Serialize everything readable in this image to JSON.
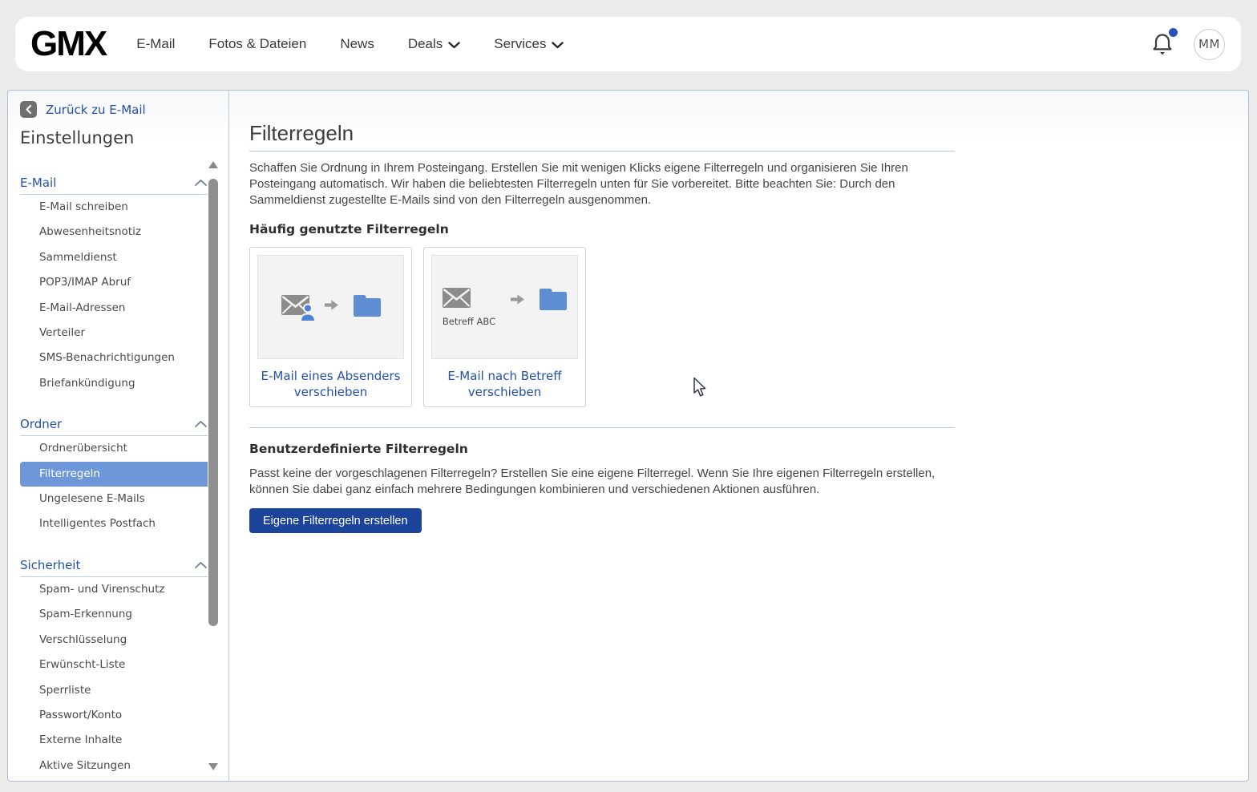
{
  "header": {
    "logo": "GMX",
    "nav": [
      {
        "label": "E-Mail",
        "has_dropdown": false
      },
      {
        "label": "Fotos & Dateien",
        "has_dropdown": false
      },
      {
        "label": "News",
        "has_dropdown": false
      },
      {
        "label": "Deals",
        "has_dropdown": true
      },
      {
        "label": "Services",
        "has_dropdown": true
      }
    ],
    "notification": {
      "icon": "bell-icon",
      "has_unread_dot": true
    },
    "avatar_initials": "MM"
  },
  "sidebar": {
    "back_link": "Zurück zu E-Mail",
    "title": "Einstellungen",
    "sections": [
      {
        "label": "E-Mail",
        "collapsed": false,
        "items": [
          {
            "label": "E-Mail schreiben",
            "selected": false
          },
          {
            "label": "Abwesenheitsnotiz",
            "selected": false
          },
          {
            "label": "Sammeldienst",
            "selected": false
          },
          {
            "label": "POP3/IMAP Abruf",
            "selected": false
          },
          {
            "label": "E-Mail-Adressen",
            "selected": false
          },
          {
            "label": "Verteiler",
            "selected": false
          },
          {
            "label": "SMS-Benachrichtigungen",
            "selected": false
          },
          {
            "label": "Briefankündigung",
            "selected": false
          }
        ]
      },
      {
        "label": "Ordner",
        "collapsed": false,
        "items": [
          {
            "label": "Ordnerübersicht",
            "selected": false
          },
          {
            "label": "Filterregeln",
            "selected": true
          },
          {
            "label": "Ungelesene E-Mails",
            "selected": false
          },
          {
            "label": "Intelligentes Postfach",
            "selected": false
          }
        ]
      },
      {
        "label": "Sicherheit",
        "collapsed": false,
        "items": [
          {
            "label": "Spam- und Virenschutz",
            "selected": false
          },
          {
            "label": "Spam-Erkennung",
            "selected": false
          },
          {
            "label": "Verschlüsselung",
            "selected": false
          },
          {
            "label": "Erwünscht-Liste",
            "selected": false
          },
          {
            "label": "Sperrliste",
            "selected": false
          },
          {
            "label": "Passwort/Konto",
            "selected": false
          },
          {
            "label": "Externe Inhalte",
            "selected": false
          },
          {
            "label": "Aktive Sitzungen",
            "selected": false
          }
        ]
      }
    ]
  },
  "main": {
    "title": "Filterregeln",
    "intro": "Schaffen Sie Ordnung in Ihrem Posteingang. Erstellen Sie mit wenigen Klicks eigene Filterregeln und organisieren Sie Ihren Posteingang automatisch. Wir haben die beliebtesten Filterregeln unten für Sie vorbereitet. Bitte beachten Sie: Durch den Sammeldienst zugestellte E-Mails sind von den Filterregeln ausgenommen.",
    "frequent": {
      "heading": "Häufig genutzte Filterregeln",
      "cards": [
        {
          "label": "E-Mail eines Absenders verschieben",
          "icon": "envelope-sender-to-folder",
          "caption": ""
        },
        {
          "label": "E-Mail nach Betreff verschieben",
          "icon": "envelope-subject-to-folder",
          "caption": "Betreff ABC"
        }
      ]
    },
    "custom": {
      "heading": "Benutzerdefinierte Filterregeln",
      "text": "Passt keine der vorgeschlagenen Filterregeln? Erstellen Sie eine eigene Filterregel. Wenn Sie Ihre eigenen Filterregeln erstellen, können Sie dabei ganz einfach mehrere Bedingungen kombinieren und verschiedenen Aktionen ausführen.",
      "button": "Eigene Filterregeln erstellen"
    }
  },
  "colors": {
    "accent_blue": "#2251a8",
    "selected_item_bg": "#6e97d9",
    "button_bg": "#1c449b",
    "folder_blue": "#5d8ed2",
    "envelope_gray": "#8c8c8c",
    "divider_blue": "#b7c9d9",
    "notification_dot": "#2a52b4",
    "page_bg": "#ebebeb"
  }
}
